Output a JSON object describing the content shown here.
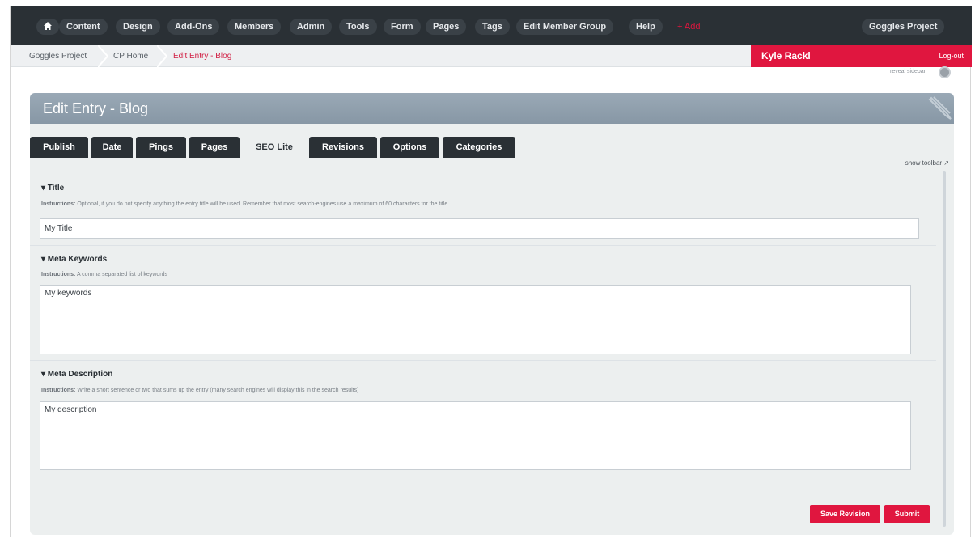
{
  "nav": {
    "items": [
      "Content",
      "Design",
      "Add-Ons",
      "Members",
      "Admin",
      "Tools",
      "Form",
      "Pages",
      "Tags",
      "Edit Member Group",
      "Help"
    ],
    "add_label": "+ Add",
    "site_label": "Goggles Project"
  },
  "breadcrumb": {
    "items": [
      "Goggles Project",
      "CP Home",
      "Edit Entry - Blog"
    ]
  },
  "user": {
    "name": "Kyle Rackl",
    "logout": "Log-out"
  },
  "reveal_sidebar": "reveal sidebar",
  "panel": {
    "title": "Edit Entry - Blog"
  },
  "tabs": [
    "Publish",
    "Date",
    "Pings",
    "Pages",
    "SEO Lite",
    "Revisions",
    "Options",
    "Categories"
  ],
  "active_tab": "SEO Lite",
  "show_toolbar": "show toolbar",
  "sections": {
    "title": {
      "label": "▾ Title",
      "instructions_prefix": "Instructions:",
      "instructions": "Optional, if you do not specify anything the entry title will be used. Remember that most search-engines use a maximum of 60 characters for the title.",
      "value": "My Title"
    },
    "keywords": {
      "label": "▾ Meta Keywords",
      "instructions_prefix": "Instructions:",
      "instructions": "A comma separated list of keywords",
      "value": "My keywords"
    },
    "description": {
      "label": "▾ Meta Description",
      "instructions_prefix": "Instructions:",
      "instructions": "Write a short sentence or two that sums up the entry (many search engines will display this in the search results)",
      "value": "My description"
    }
  },
  "buttons": {
    "save_revision": "Save Revision",
    "submit": "Submit"
  },
  "colors": {
    "accent": "#e0163f",
    "nav_bg": "#2a3035",
    "panel_head": "#8fa0ad"
  },
  "icons": [
    "home-icon",
    "pencil-icon",
    "reveal-sidebar-icon"
  ]
}
